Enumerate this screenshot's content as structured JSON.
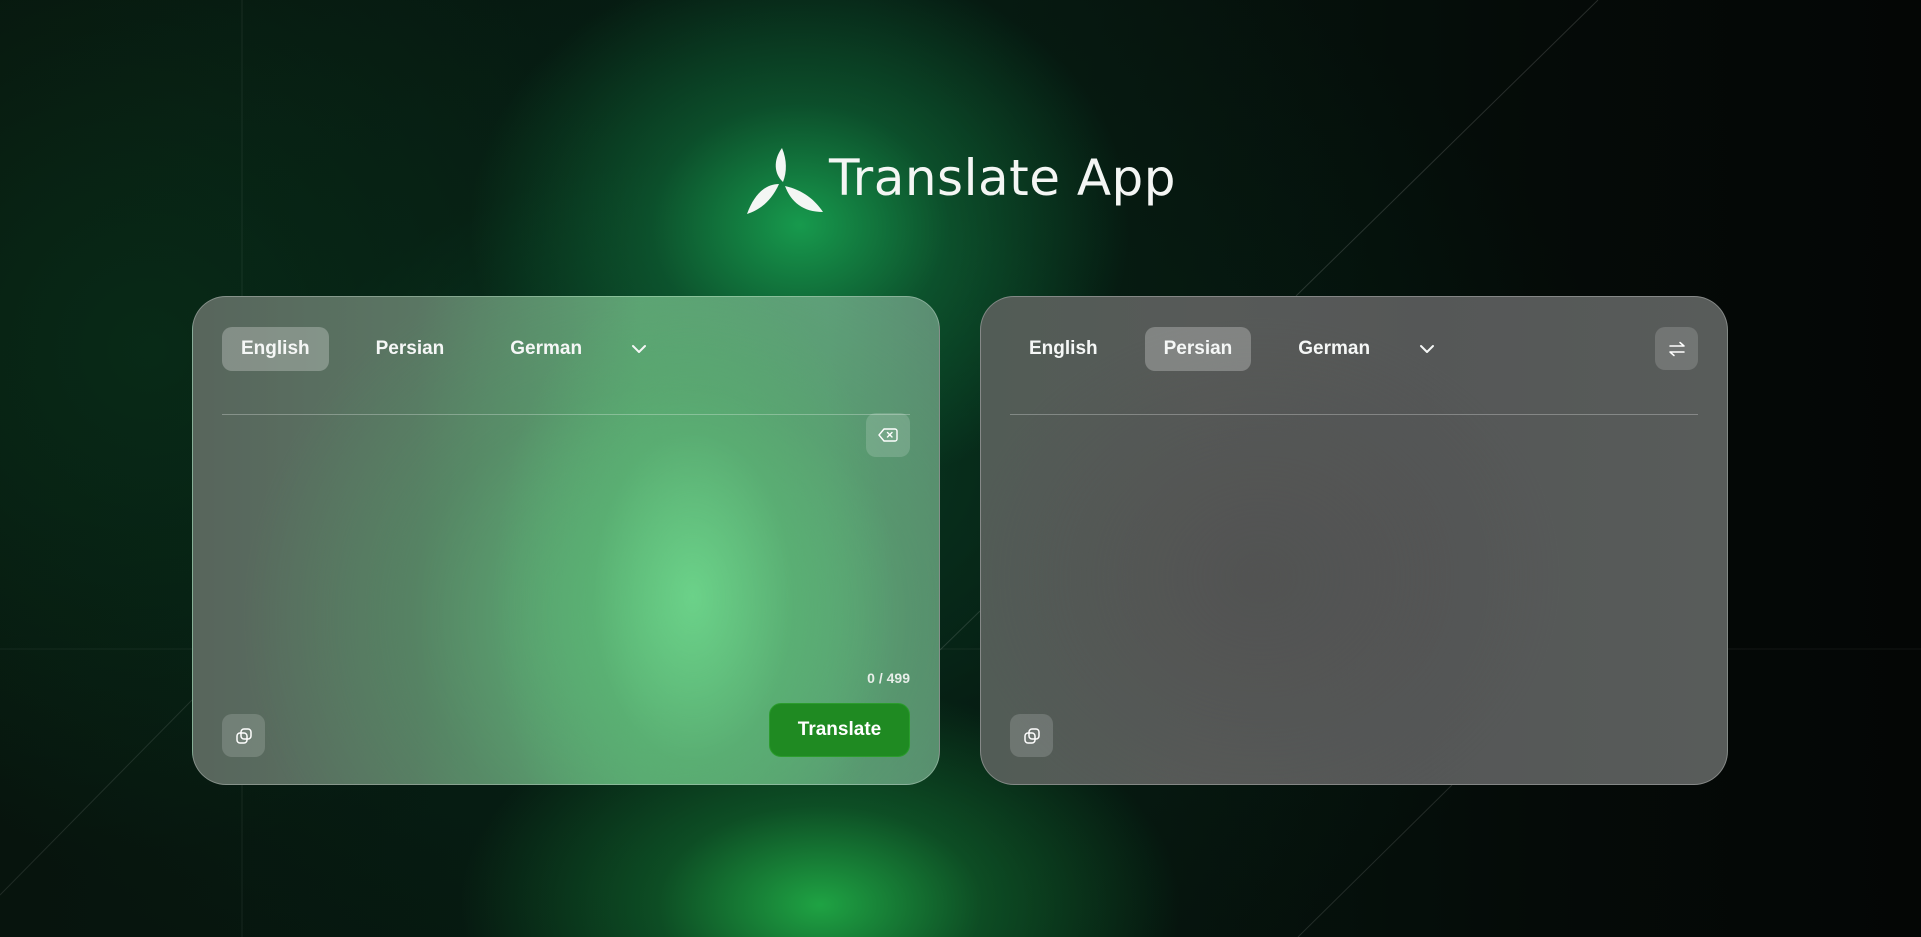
{
  "app": {
    "title": "Translate App",
    "logo_icon": "tri-leaf-logo-icon"
  },
  "source_panel": {
    "languages": [
      {
        "label": "English",
        "selected": true
      },
      {
        "label": "Persian",
        "selected": false
      },
      {
        "label": "German",
        "selected": false
      }
    ],
    "more_languages_icon": "chevron-down-icon",
    "input_value": "",
    "input_placeholder": "",
    "clear_icon": "backspace-clear-icon",
    "char_count": "0 / 499",
    "copy_icon": "copy-icon",
    "translate_label": "Translate"
  },
  "target_panel": {
    "languages": [
      {
        "label": "English",
        "selected": false
      },
      {
        "label": "Persian",
        "selected": true
      },
      {
        "label": "German",
        "selected": false
      }
    ],
    "more_languages_icon": "chevron-down-icon",
    "swap_icon": "swap-arrows-icon",
    "output_text": "",
    "copy_icon": "copy-icon"
  },
  "colors": {
    "accent_green": "#1f8a22",
    "text": "#ffffff",
    "background_dark": "#050807"
  }
}
